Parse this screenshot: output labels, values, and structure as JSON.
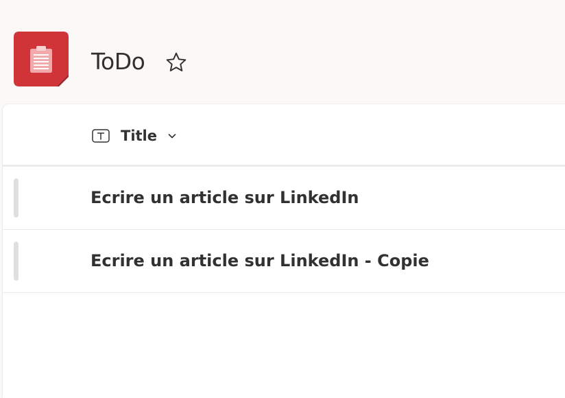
{
  "header": {
    "title": "ToDo",
    "app_icon": "clipboard-list-icon",
    "favorite_icon": "star-outline-icon"
  },
  "list": {
    "columns": [
      {
        "label": "Title",
        "type_icon": "text-type-icon",
        "sort_icon": "chevron-down-icon"
      }
    ],
    "rows": [
      {
        "title": "Ecrire un article sur LinkedIn"
      },
      {
        "title": "Ecrire un article sur LinkedIn - Copie"
      }
    ]
  },
  "colors": {
    "brand": "#d13438",
    "page_background": "#faf9f8",
    "card_background": "#ffffff",
    "text": "#323130",
    "divider": "#edebe9"
  }
}
